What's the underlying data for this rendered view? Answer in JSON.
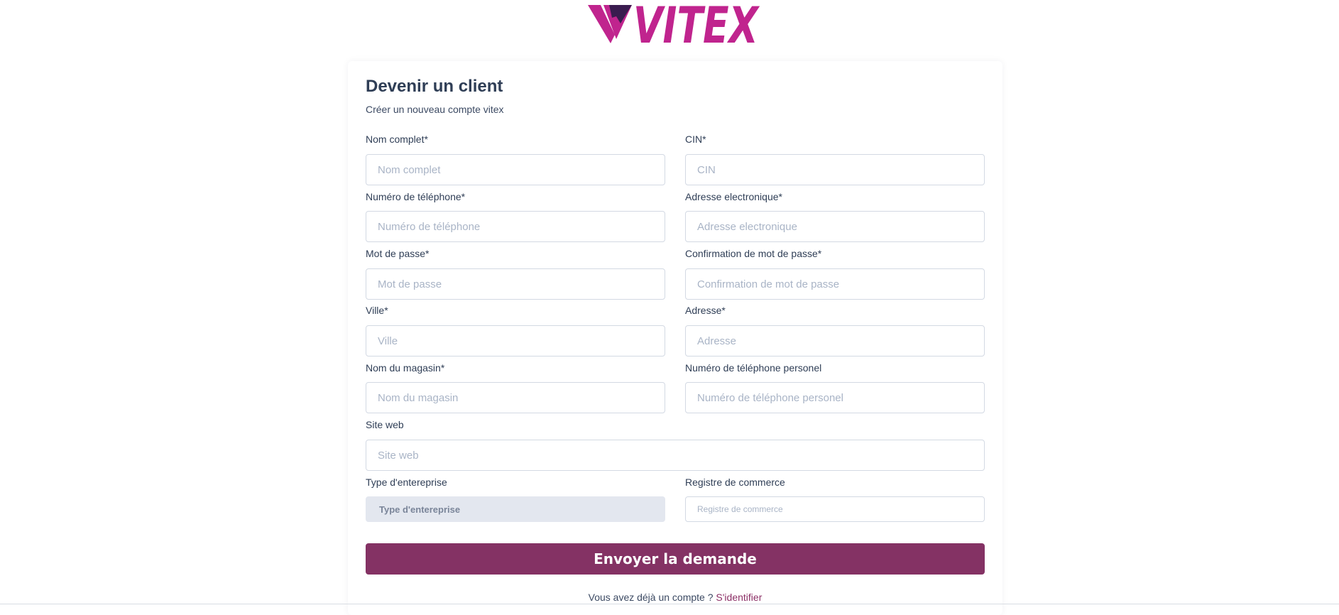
{
  "brand": {
    "logo_text": "VITEX",
    "color": "#c0248e",
    "accent": "#3a1c4f"
  },
  "form": {
    "title": "Devenir un client",
    "subtitle": "Créer un nouveau compte vitex",
    "fields": {
      "nom_complet": {
        "label": "Nom complet*",
        "placeholder": "Nom complet"
      },
      "cin": {
        "label": "CIN*",
        "placeholder": "CIN"
      },
      "telephone": {
        "label": "Numéro de téléphone*",
        "placeholder": "Numéro de téléphone"
      },
      "email": {
        "label": "Adresse electronique*",
        "placeholder": "Adresse electronique"
      },
      "password": {
        "label": "Mot de passe*",
        "placeholder": "Mot de passe"
      },
      "password_confirm": {
        "label": "Confirmation de mot de passe*",
        "placeholder": "Confirmation de mot de passe"
      },
      "ville": {
        "label": "Ville*",
        "placeholder": "Ville"
      },
      "adresse": {
        "label": "Adresse*",
        "placeholder": "Adresse"
      },
      "magasin": {
        "label": "Nom du magasin*",
        "placeholder": "Nom du magasin"
      },
      "telephone_perso": {
        "label": "Numéro de téléphone personel",
        "placeholder": "Numéro de téléphone personel"
      },
      "site_web": {
        "label": "Site web",
        "placeholder": "Site web"
      },
      "type_entreprise": {
        "label": "Type d'entereprise",
        "selected": "Type d'entereprise"
      },
      "registre": {
        "label": "Registre de commerce",
        "placeholder": "Registre de commerce"
      }
    },
    "submit_label": "Envoyer la demande",
    "footer_text": "Vous avez déjà un compte ? ",
    "footer_link": "S'identifier",
    "submit_color": "#843264"
  }
}
